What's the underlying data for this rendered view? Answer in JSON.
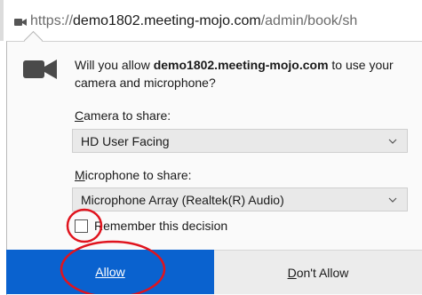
{
  "address_bar": {
    "icon": "camera-icon",
    "url_prefix": "https://",
    "url_domain": "demo1802.meeting-mojo.com",
    "url_path": "/admin/book/sh"
  },
  "prompt": {
    "icon": "camera-icon",
    "question_before": "Will you allow ",
    "question_site": "demo1802.meeting-mojo.com",
    "question_after": " to use your camera and microphone?",
    "camera_label_key": "C",
    "camera_label_rest": "amera to share:",
    "camera_selected": "HD User Facing",
    "microphone_label_key": "M",
    "microphone_label_rest": "icrophone to share:",
    "microphone_selected": "Microphone Array (Realtek(R) Audio)",
    "remember_label": "Remember this decision",
    "remember_checked": false
  },
  "buttons": {
    "allow_label": "Allow",
    "deny_label_key": "D",
    "deny_label_rest": "on't Allow"
  },
  "colors": {
    "allow_bg": "#0a62cf",
    "annotation_red": "#e0141e"
  }
}
